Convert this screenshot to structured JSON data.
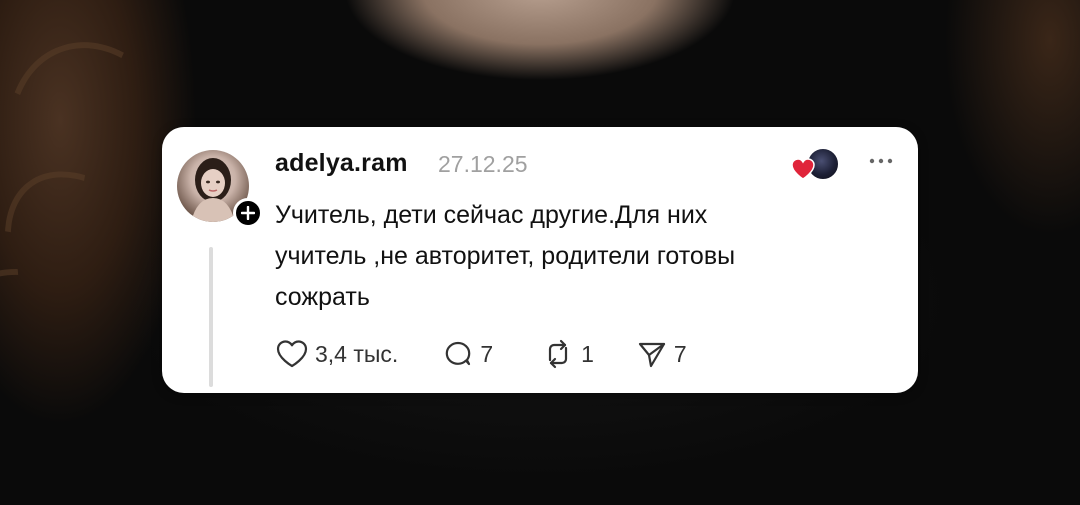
{
  "post": {
    "username": "adelya.ram",
    "date": "27.12.25",
    "text_lines": [
      "Учитель, дети сейчас другие.Для них",
      "учитель ,не авторитет, родители готовы",
      "сожрать"
    ],
    "actions": {
      "likes": "3,4 тыс.",
      "comments": "7",
      "reposts": "1",
      "shares": "7"
    }
  },
  "icons": {
    "follow": "plus-icon",
    "more": "more-horizontal-icon",
    "like": "heart-outline-icon",
    "comment": "comment-bubble-icon",
    "repost": "repost-icon",
    "share": "send-icon",
    "reaction": "heart-filled-icon"
  },
  "colors": {
    "card_background": "#ffffff",
    "text": "#111111",
    "secondary_text": "#a0a0a0",
    "reaction_heart": "#e0243a"
  }
}
